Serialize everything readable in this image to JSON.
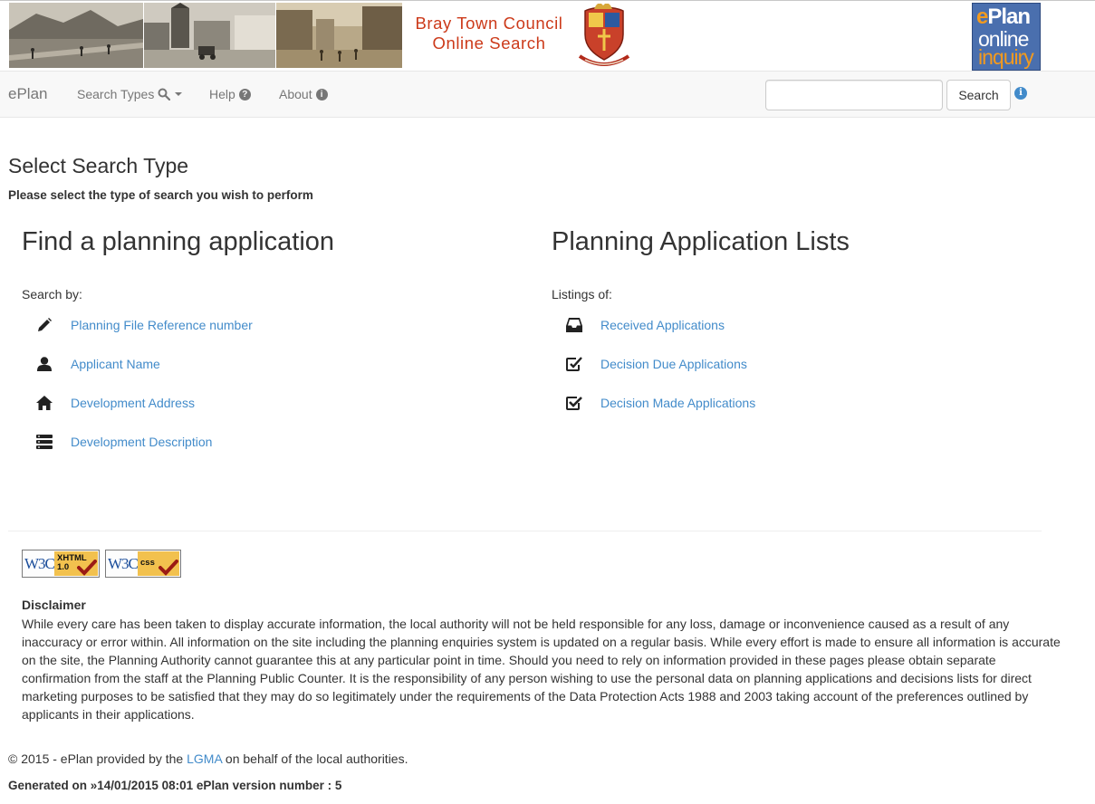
{
  "header": {
    "council_title_line1": "Bray Town Council",
    "council_title_line2": "Online Search",
    "logo_word_e": "e",
    "logo_word_plan": "Plan",
    "logo_word_online": "online",
    "logo_word_inquiry": "inquiry"
  },
  "navbar": {
    "brand": "ePlan",
    "search_types_label": "Search Types",
    "help_label": "Help",
    "about_label": "About",
    "search_input_value": "",
    "search_button_label": "Search"
  },
  "main": {
    "title": "Select Search Type",
    "subtitle": "Please select the type of search you wish to perform",
    "find": {
      "heading": "Find a planning application",
      "label": "Search by:",
      "links": [
        {
          "label": "Planning File Reference number",
          "icon": "pencil-icon"
        },
        {
          "label": "Applicant Name",
          "icon": "user-icon"
        },
        {
          "label": "Development Address",
          "icon": "home-icon"
        },
        {
          "label": "Development Description",
          "icon": "list-icon"
        }
      ]
    },
    "lists": {
      "heading": "Planning Application Lists",
      "label": "Listings of:",
      "links": [
        {
          "label": "Received Applications",
          "icon": "inbox-icon"
        },
        {
          "label": "Decision Due Applications",
          "icon": "edit-check-icon"
        },
        {
          "label": "Decision Made Applications",
          "icon": "checked-box-icon"
        }
      ]
    }
  },
  "footer": {
    "badges": {
      "w3c_text": "W3C",
      "xhtml_line1": "XHTML",
      "xhtml_line2": "1.0",
      "css_text": "css"
    },
    "disclaimer_title": "Disclaimer",
    "disclaimer_text": "While every care has been taken to display accurate information, the local authority will not be held responsible for any loss, damage or inconvenience caused as a result of any inaccuracy or error within. All information on the site including the planning enquiries system is updated on a regular basis. While every effort is made to ensure all information is accurate on the site, the Planning Authority cannot guarantee this at any particular point in time. Should you need to rely on information provided in these pages please obtain separate confirmation from the staff at the Planning Public Counter. It is the responsibility of any person wishing to use the personal data on planning applications and decisions lists for direct marketing purposes to be satisfied that they may do so legitimately under the requirements of the Data Protection Acts 1988 and 2003 taking account of the preferences outlined by applicants in their applications.",
    "copyright_prefix": "© 2015 - ePlan provided by the",
    "copyright_link": "LGMA",
    "copyright_suffix": "on behalf of the local authorities.",
    "generated": "Generated on »14/01/2015 08:01 ePlan version number : 5"
  },
  "colors": {
    "link": "#428bca",
    "council_title": "#cc3a1a",
    "navbar_bg": "#f8f8f8",
    "text": "#333333"
  }
}
